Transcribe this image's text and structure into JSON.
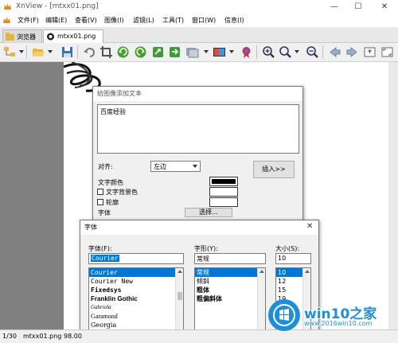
{
  "window": {
    "title": "XnView - [mtxx01.png]"
  },
  "menu": [
    "文件(F)",
    "编辑(E)",
    "查看(V)",
    "图像(I)",
    "滤镜(L)",
    "工具(T)",
    "窗口(W)",
    "信息(I)"
  ],
  "tabs": [
    {
      "label": "浏览器"
    },
    {
      "label": "mtxx01.png"
    }
  ],
  "toolbar_icons": [
    "browser-icon",
    "open-folder-icon",
    "save-icon",
    "undo-icon",
    "crop-icon",
    "rotate-left-icon",
    "rotate-right-icon",
    "flip-icon",
    "export-icon",
    "slideshow-icon",
    "adjust-icon",
    "effects-icon",
    "zoom-in-icon",
    "zoom-icon",
    "zoom-out-icon",
    "previous-icon",
    "next-icon",
    "fit-icon",
    "fullscreen-icon"
  ],
  "text_dialog": {
    "title": "给图像添加文本",
    "text_value": "百度经验",
    "align_label": "对齐:",
    "align_value": "左边",
    "insert_button": "插入>>",
    "text_color_label": "文字颜色",
    "bg_color_label": "文字背景色",
    "outline_label": "轮廓",
    "font_label": "字体",
    "choose_button": "选择...",
    "text_color": "#000000",
    "bg_color": "#ffffff"
  },
  "font_dialog": {
    "title": "字体",
    "font_label": "字体(F):",
    "style_label": "字形(Y):",
    "size_label": "大小(S):",
    "font_value": "Courier",
    "style_value": "常规",
    "size_value": "10",
    "fonts": [
      "Courier",
      "Courier New",
      "Fixedsys",
      "Franklin Gothic",
      "Gabriola",
      "Garamond",
      "Georgia"
    ],
    "selected_font": "Courier",
    "styles": [
      "常规",
      "倾斜",
      "粗体",
      "粗偏斜体"
    ],
    "selected_style": "常规",
    "sizes": [
      "10",
      "12",
      "15",
      "19"
    ],
    "selected_size": "10"
  },
  "status": {
    "index": "1/30",
    "filename": "mtxx01.png",
    "zoom": "98.00"
  },
  "watermark": {
    "logo": "win10之家",
    "url": "www.2016win10.com"
  },
  "colors": {
    "accent": "#0078d7",
    "logo_blue": "#1e8fd6"
  }
}
